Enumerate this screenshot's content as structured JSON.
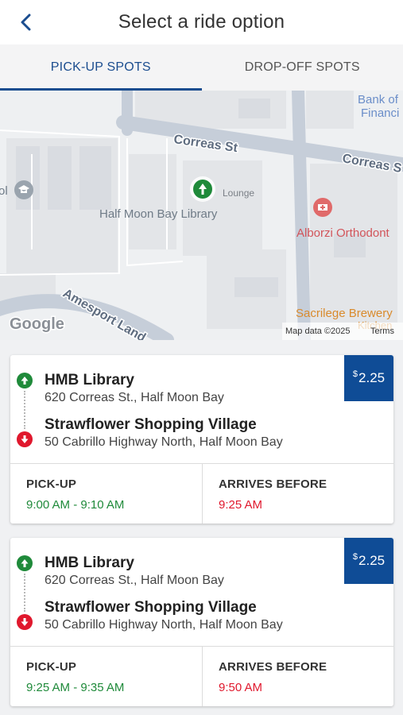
{
  "header": {
    "title": "Select a ride option",
    "back_icon": "chevron-left-icon"
  },
  "tabs": [
    {
      "label": "PICK-UP SPOTS",
      "active": true
    },
    {
      "label": "DROP-OFF SPOTS",
      "active": false
    }
  ],
  "map": {
    "labels": {
      "street1": "Correas St",
      "street2": "Correas S",
      "street3": "Amesport Land",
      "library": "Half Moon Bay Library",
      "lounge": "Lounge",
      "bank1": "Bank of",
      "bank2": "Financi",
      "ortho": "Alborzi Orthodont",
      "brewery": "Sacrilege Brewery",
      "kitchen": "Kitchen",
      "school": "ol",
      "google": "Google",
      "map_data": "Map data ©2025",
      "terms": "Terms"
    },
    "colors": {
      "road": "#c9d1dc",
      "block": "#e4e6e9",
      "accent_green": "#1f8a3a",
      "poi_red": "#e06a6a",
      "poi_orange": "#e0892c"
    }
  },
  "rides": [
    {
      "price": "2.25",
      "price_symbol": "$",
      "origin_name": "HMB Library",
      "origin_address": "620 Correas St., Half Moon Bay",
      "destination_name": "Strawflower Shopping Village",
      "destination_address": "50 Cabrillo Highway North, Half Moon Bay",
      "pickup_label": "PICK-UP",
      "pickup_time": "9:00 AM - 9:10 AM",
      "arrive_label": "ARRIVES BEFORE",
      "arrive_time": "9:25 AM"
    },
    {
      "price": "2.25",
      "price_symbol": "$",
      "origin_name": "HMB Library",
      "origin_address": "620 Correas St., Half Moon Bay",
      "destination_name": "Strawflower Shopping Village",
      "destination_address": "50 Cabrillo Highway North, Half Moon Bay",
      "pickup_label": "PICK-UP",
      "pickup_time": "9:25 AM - 9:35 AM",
      "arrive_label": "ARRIVES BEFORE",
      "arrive_time": "9:50 AM"
    }
  ],
  "colors": {
    "brand_blue": "#0f4c96",
    "tab_active": "#1b4d8f",
    "green": "#1f8a3a",
    "red": "#e0182d"
  }
}
